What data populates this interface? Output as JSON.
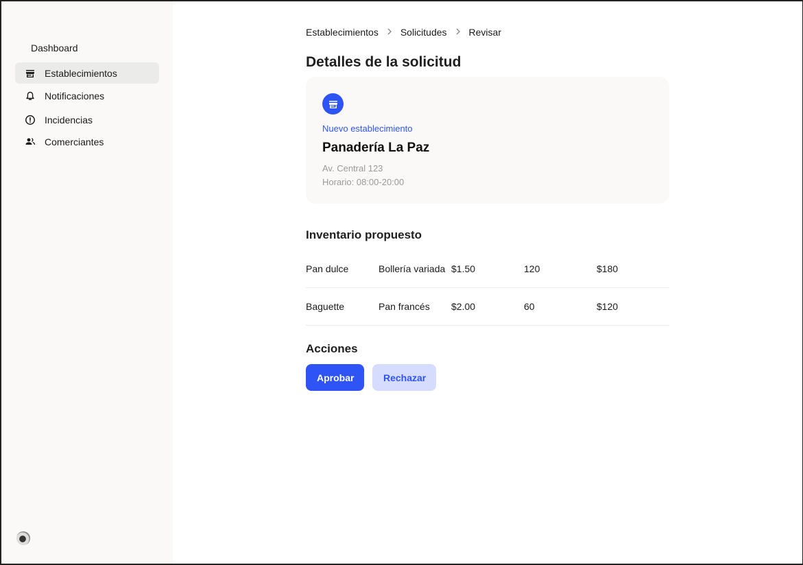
{
  "sidebar": {
    "dashboard_label": "Dashboard",
    "items": [
      {
        "label": "Establecimientos",
        "icon": "store-icon",
        "active": true
      },
      {
        "label": "Notificaciones",
        "icon": "bell-icon",
        "active": false
      },
      {
        "label": "Incidencias",
        "icon": "alert-circle-icon",
        "active": false
      },
      {
        "label": "Comerciantes",
        "icon": "users-icon",
        "active": false
      }
    ]
  },
  "breadcrumb": [
    "Establecimientos",
    "Solicitudes",
    "Revisar"
  ],
  "page_title": "Detalles de la solicitud",
  "request": {
    "kind": "Nuevo establecimiento",
    "name": "Panadería La Paz",
    "address": "Av. Central 123",
    "hours": "Horario: 08:00-20:00",
    "icon": "store-icon",
    "accent_color": "#2f54f5"
  },
  "inventory": {
    "title": "Inventario propuesto",
    "rows": [
      [
        "Pan dulce",
        "Bollería variada",
        "$1.50",
        "120",
        "$180"
      ],
      [
        "Baguette",
        "Pan francés",
        "$2.00",
        "60",
        "$120"
      ]
    ]
  },
  "actions": {
    "title": "Acciones",
    "approve_label": "Aprobar",
    "reject_label": "Rechazar"
  }
}
